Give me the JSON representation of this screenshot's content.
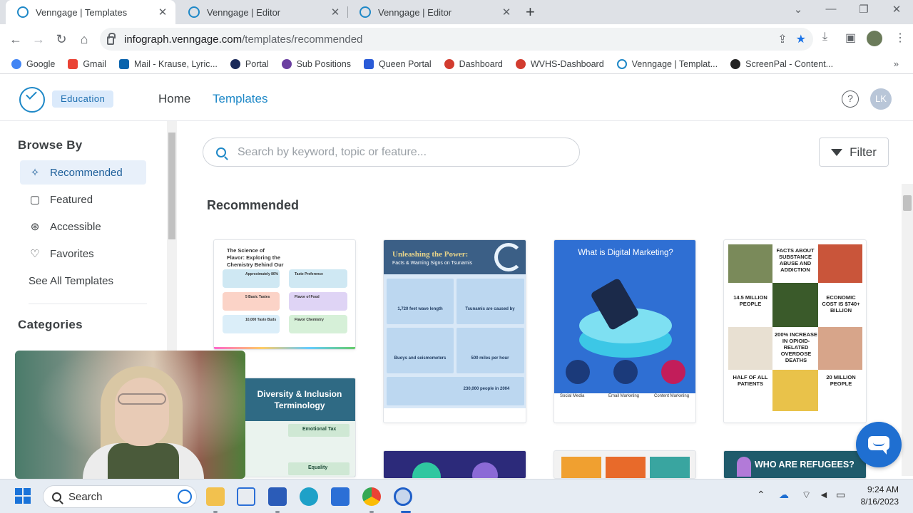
{
  "browser": {
    "tabs": [
      {
        "title": "Venngage | Templates",
        "active": true
      },
      {
        "title": "Venngage | Editor",
        "active": false
      },
      {
        "title": "Venngage | Editor",
        "active": false
      }
    ],
    "url_host": "infograph.venngage.com",
    "url_path": "/templates/recommended",
    "bookmarks": [
      {
        "label": "Google",
        "color": "#4285f4"
      },
      {
        "label": "Gmail",
        "color": "#ea4335"
      },
      {
        "label": "Mail - Krause, Lyric...",
        "color": "#0a64ad"
      },
      {
        "label": "Portal",
        "color": "#1b2a5a"
      },
      {
        "label": "Sub Positions",
        "color": "#6b3fa0"
      },
      {
        "label": "Queen Portal",
        "color": "#2a5bd7"
      },
      {
        "label": "Dashboard",
        "color": "#d23c2f"
      },
      {
        "label": "WVHS-Dashboard",
        "color": "#d23c2f"
      },
      {
        "label": "Venngage | Templat...",
        "color": "#1e88c7"
      },
      {
        "label": "ScreenPal - Content...",
        "color": "#222222"
      }
    ],
    "more_bookmarks": "»"
  },
  "app": {
    "badge": "Education",
    "nav": {
      "home": "Home",
      "templates": "Templates"
    },
    "help": "?",
    "avatar_initials": "LK",
    "accent_color": "#1e88c7"
  },
  "sidebar": {
    "browse_heading": "Browse By",
    "items": [
      {
        "label": "Recommended",
        "icon": "sparkle-icon",
        "active": true
      },
      {
        "label": "Featured",
        "icon": "featured-icon",
        "active": false
      },
      {
        "label": "Accessible",
        "icon": "accessibility-icon",
        "active": false
      },
      {
        "label": "Favorites",
        "icon": "heart-icon",
        "active": false
      }
    ],
    "see_all": "See All Templates",
    "categories_heading": "Categories"
  },
  "main": {
    "search_placeholder": "Search by keyword, topic or feature...",
    "filter_label": "Filter",
    "section_title": "Recommended"
  },
  "templates": [
    {
      "title": "The Science of Flavor: Exploring the Chemistry Behind Our Favorite Tastes",
      "rows": [
        "Approximately 80%",
        "Taste Preference",
        "5 Basic Tastes",
        "Flavor of Food",
        "10,000 Taste Buds",
        "Flavor Chemistry"
      ]
    },
    {
      "title": "Unleashing the Power:",
      "subtitle": "Facts & Warning Signs on Tsunamis",
      "facts": [
        "1,720 feet wave length",
        "Tsunamis are caused by",
        "Buoys and seismometers",
        "500 miles per hour",
        "230,000 people in 2004"
      ]
    },
    {
      "title": "What is Digital Marketing?",
      "labels": [
        "Social Media",
        "Email Marketing",
        "Content Marketing"
      ]
    },
    {
      "title": "FACTS ABOUT SUBSTANCE ABUSE AND ADDICTION",
      "facts": [
        "14.5 MILLION PEOPLE",
        "ECONOMIC COST IS $740+ BILLION",
        "200% INCREASE IN OPIOID-RELATED OVERDOSE DEATHS",
        "HALF OF ALL PATIENTS",
        "20 MILLION PEOPLE"
      ]
    },
    {
      "title": "Diversity & Inclusion Terminology",
      "labels": [
        "Emotional Tax",
        "Equality"
      ]
    },
    {
      "title": ""
    },
    {
      "title": ""
    },
    {
      "title": "WHO ARE REFUGEES?"
    }
  ],
  "taskbar": {
    "search_label": "Search",
    "time": "9:24 AM",
    "date": "8/16/2023"
  }
}
